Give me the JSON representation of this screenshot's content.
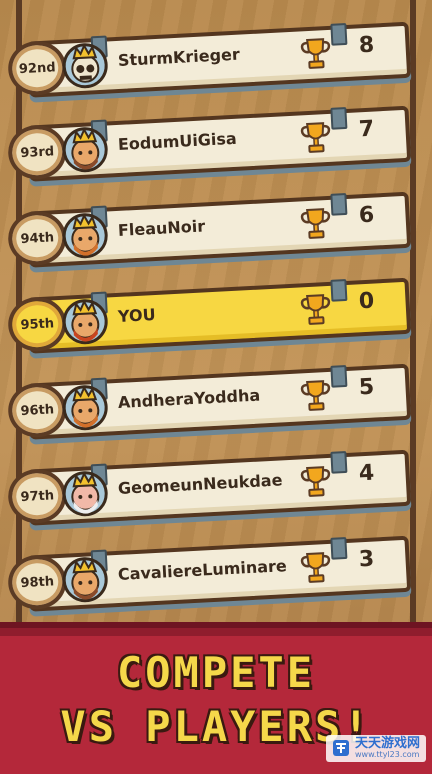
{
  "leaderboard": {
    "rows": [
      {
        "rank": "92nd",
        "name": "SturmKrieger",
        "score": "8",
        "avatar": "skull-king",
        "you": false
      },
      {
        "rank": "93rd",
        "name": "EodumUiGisa",
        "score": "7",
        "avatar": "bearded-king",
        "you": false
      },
      {
        "rank": "94th",
        "name": "FleauNoir",
        "score": "6",
        "avatar": "elf-king",
        "you": false
      },
      {
        "rank": "95th",
        "name": "YOU",
        "score": "0",
        "avatar": "red-haired-king",
        "you": true
      },
      {
        "rank": "96th",
        "name": "AndheraYoddha",
        "score": "5",
        "avatar": "elf-king",
        "you": false
      },
      {
        "rank": "97th",
        "name": "GeomeunNeukdae",
        "score": "4",
        "avatar": "old-dwarf",
        "you": false
      },
      {
        "rank": "98th",
        "name": "CavaliereLuminare",
        "score": "3",
        "avatar": "bearded-king",
        "you": false
      }
    ]
  },
  "banner": {
    "line1": "COMPETE",
    "line2": "VS PLAYERS!"
  },
  "watermark": {
    "main": "天天游戏网",
    "sub": "www.ttyl23.com"
  },
  "colors": {
    "card": "#f3ecd8",
    "you_card": "#f7d742",
    "banner": "#b4283a",
    "banner_text": "#f5d84a"
  }
}
